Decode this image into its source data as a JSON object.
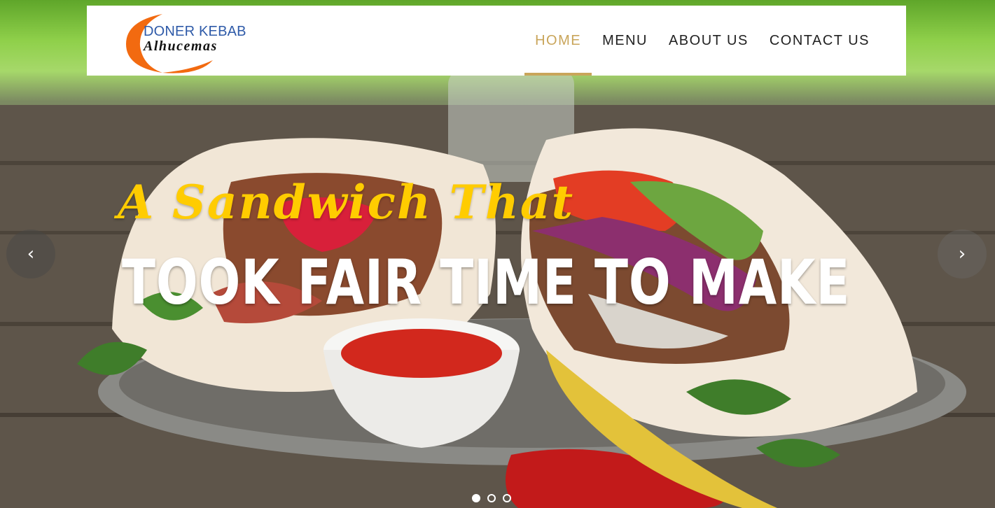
{
  "logo": {
    "line1": "DONER KEBAB",
    "line2": "Alhucemas"
  },
  "nav": {
    "items": [
      "HOME",
      "MENU",
      "ABOUT US",
      "CONTACT US"
    ],
    "active": "HOME"
  },
  "hero": {
    "script_line": "A Sandwich That",
    "main_line": "TOOK FAIR TIME TO MAKE"
  },
  "slider": {
    "prev_icon": "‹",
    "next_icon": "›",
    "slide_count": 3,
    "active_slide": 1
  },
  "colors": {
    "accent": "#c9a55a",
    "script_text": "#ffcc00",
    "logo_blue": "#2e5aa8",
    "logo_swoosh": "#f26a10"
  }
}
